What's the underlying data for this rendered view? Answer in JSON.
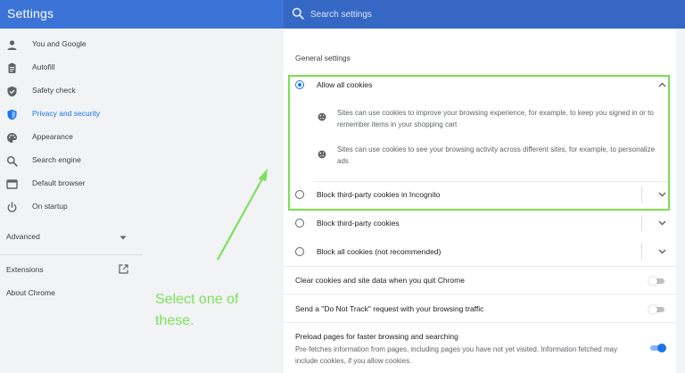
{
  "header": {
    "title": "Settings",
    "search_placeholder": "Search settings"
  },
  "sidebar": {
    "items": [
      {
        "label": "You and Google",
        "icon": "person-icon"
      },
      {
        "label": "Autofill",
        "icon": "clipboard-icon"
      },
      {
        "label": "Safety check",
        "icon": "shield-check-icon"
      },
      {
        "label": "Privacy and security",
        "icon": "shield-icon",
        "active": true
      },
      {
        "label": "Appearance",
        "icon": "palette-icon"
      },
      {
        "label": "Search engine",
        "icon": "search-icon"
      },
      {
        "label": "Default browser",
        "icon": "browser-icon"
      },
      {
        "label": "On startup",
        "icon": "power-icon"
      }
    ],
    "advanced": "Advanced",
    "extensions": "Extensions",
    "about": "About Chrome"
  },
  "annotation": {
    "text": "Select one of these."
  },
  "main": {
    "section_title": "General settings",
    "options": [
      {
        "label": "Allow all cookies",
        "checked": true,
        "expanded": true
      },
      {
        "label": "Block third-party cookies in Incognito",
        "checked": false
      },
      {
        "label": "Block third-party cookies",
        "checked": false
      },
      {
        "label": "Block all cookies (not recommended)",
        "checked": false
      }
    ],
    "details": [
      "Sites can use cookies to improve your browsing experience, for example, to keep you signed in or to remember items in your shopping cart",
      "Sites can use cookies to see your browsing activity across different sites, for example, to personalize ads"
    ],
    "toggles": [
      {
        "label": "Clear cookies and site data when you quit Chrome",
        "on": false
      },
      {
        "label": "Send a \"Do Not Track\" request with your browsing traffic",
        "on": false
      },
      {
        "label": "Preload pages for faster browsing and searching",
        "description": "Pre-fetches information from pages, including pages you have not yet visited. Information fetched may include cookies, if you allow cookies.",
        "on": true
      }
    ]
  },
  "colors": {
    "header": "#3b74d6",
    "accent": "#1a73e8",
    "annotation": "#7ee05d"
  }
}
